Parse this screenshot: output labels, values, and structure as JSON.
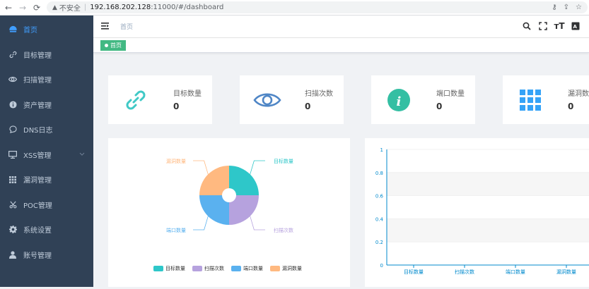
{
  "browser": {
    "security_label": "不安全",
    "host": "192.168.202.128",
    "path": ":11000/#/dashboard"
  },
  "sidebar": {
    "items": [
      {
        "label": "首页",
        "icon": "dashboard-icon",
        "active": true
      },
      {
        "label": "目标管理",
        "icon": "link-icon"
      },
      {
        "label": "扫描管理",
        "icon": "eye-icon"
      },
      {
        "label": "资产管理",
        "icon": "info-icon"
      },
      {
        "label": "DNS日志",
        "icon": "chat-icon"
      },
      {
        "label": "XSS管理",
        "icon": "monitor-icon",
        "has_submenu": true
      },
      {
        "label": "漏洞管理",
        "icon": "grid-icon"
      },
      {
        "label": "POC管理",
        "icon": "scissors-icon"
      },
      {
        "label": "系统设置",
        "icon": "gear-icon"
      },
      {
        "label": "账号管理",
        "icon": "user-icon"
      }
    ]
  },
  "header": {
    "breadcrumb": "首页"
  },
  "tags": {
    "active_label": "首页"
  },
  "cards": [
    {
      "title": "目标数量",
      "value": "0",
      "icon": "link-icon",
      "color": "#40c9c6"
    },
    {
      "title": "扫描次数",
      "value": "0",
      "icon": "eye-icon",
      "color": "#4f86c6"
    },
    {
      "title": "端口数量",
      "value": "0",
      "icon": "info-icon",
      "color": "#34bfa3"
    },
    {
      "title": "漏洞数",
      "value": "0",
      "icon": "grid-icon",
      "color": "#36a3f7"
    }
  ],
  "chart_data": [
    {
      "type": "pie",
      "categories": [
        "目标数量",
        "扫描次数",
        "端口数量",
        "漏洞数量"
      ],
      "values": [
        1,
        1,
        1,
        1
      ],
      "colors": [
        "#2ec7c9",
        "#b6a2de",
        "#5ab1ef",
        "#ffb980"
      ],
      "legend": "bottom"
    },
    {
      "type": "bar",
      "categories": [
        "目标数量",
        "扫描次数",
        "端口数量",
        "漏洞数量"
      ],
      "values": [
        0,
        0,
        0,
        0
      ],
      "ylim": [
        0,
        1
      ],
      "yticks": [
        "0",
        "0.2",
        "0.4",
        "0.6",
        "0.8",
        "1"
      ],
      "axis_color": "#008acd"
    }
  ]
}
